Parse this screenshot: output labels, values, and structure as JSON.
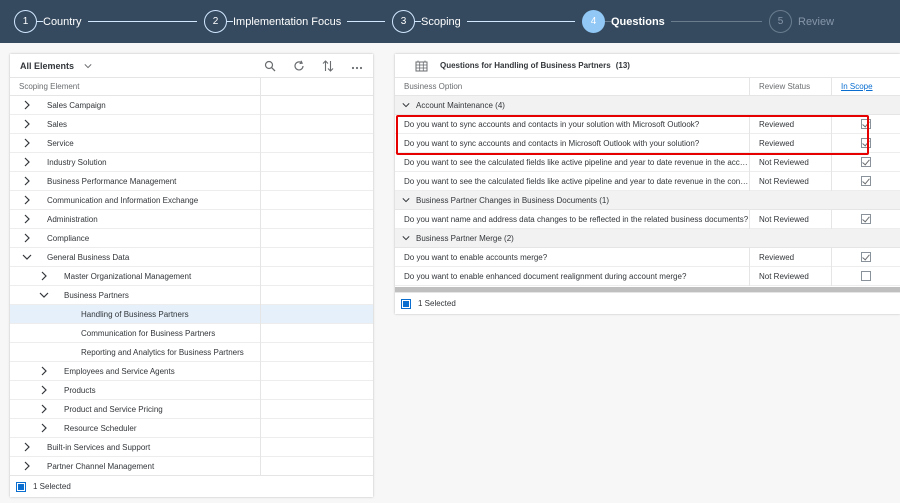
{
  "wizard": {
    "steps": [
      {
        "number": "1",
        "label": "Country"
      },
      {
        "number": "2",
        "label": "Implementation Focus"
      },
      {
        "number": "3",
        "label": "Scoping"
      },
      {
        "number": "4",
        "label": "Questions"
      },
      {
        "number": "5",
        "label": "Review"
      }
    ],
    "active_step": "4"
  },
  "left": {
    "filter_label": "All Elements",
    "column_header": "Scoping Element",
    "rows": [
      {
        "label": "Sales Campaign",
        "level": 0,
        "expanded": false
      },
      {
        "label": "Sales",
        "level": 0,
        "expanded": false
      },
      {
        "label": "Service",
        "level": 0,
        "expanded": false
      },
      {
        "label": "Industry Solution",
        "level": 0,
        "expanded": false
      },
      {
        "label": "Business Performance Management",
        "level": 0,
        "expanded": false
      },
      {
        "label": "Communication and Information Exchange",
        "level": 0,
        "expanded": false
      },
      {
        "label": "Administration",
        "level": 0,
        "expanded": false
      },
      {
        "label": "Compliance",
        "level": 0,
        "expanded": false
      },
      {
        "label": "General Business Data",
        "level": 0,
        "expanded": true
      },
      {
        "label": "Master Organizational Management",
        "level": 1,
        "expanded": false
      },
      {
        "label": "Business Partners",
        "level": 1,
        "expanded": true
      },
      {
        "label": "Handling of Business Partners",
        "level": 2,
        "selected": true
      },
      {
        "label": "Communication for Business Partners",
        "level": 2
      },
      {
        "label": "Reporting and Analytics for Business Partners",
        "level": 2
      },
      {
        "label": "Employees and Service Agents",
        "level": 1,
        "expanded": false
      },
      {
        "label": "Products",
        "level": 1,
        "expanded": false
      },
      {
        "label": "Product and Service Pricing",
        "level": 1,
        "expanded": false
      },
      {
        "label": "Resource Scheduler",
        "level": 1,
        "expanded": false
      },
      {
        "label": "Built-in Services and Support",
        "level": 0,
        "expanded": false
      },
      {
        "label": "Partner Channel Management",
        "level": 0,
        "expanded": false
      }
    ],
    "footer_text": "1 Selected"
  },
  "right": {
    "title": "Questions for Handling of Business Partners",
    "count": "(13)",
    "headers": {
      "option": "Business Option",
      "status": "Review Status",
      "scope": "In Scope"
    },
    "groups": [
      {
        "label": "Account Maintenance (4)",
        "rows": [
          {
            "option": "Do you want to sync accounts and contacts in your solution with Microsoft Outlook?",
            "status": "Reviewed",
            "in_scope": true
          },
          {
            "option": "Do you want to sync accounts and contacts in Microsoft Outlook with your solution?",
            "status": "Reviewed",
            "in_scope": true
          },
          {
            "option": "Do you want to see the calculated fields like active pipeline and year to date revenue in the account data?",
            "status": "Not Reviewed",
            "in_scope": true
          },
          {
            "option": "Do you want to see the calculated fields like active pipeline and year to date revenue in the contact data?",
            "status": "Not Reviewed",
            "in_scope": true
          }
        ]
      },
      {
        "label": "Business Partner Changes in Business Documents (1)",
        "rows": [
          {
            "option": "Do you want name and address data changes to be reflected in the related business documents?",
            "status": "Not Reviewed",
            "in_scope": true
          }
        ]
      },
      {
        "label": "Business Partner Merge (2)",
        "rows": [
          {
            "option": "Do you want to enable accounts merge?",
            "status": "Reviewed",
            "in_scope": true
          },
          {
            "option": "Do you want to enable enhanced document realignment during account merge?",
            "status": "Not Reviewed",
            "in_scope": false
          }
        ]
      }
    ],
    "footer_text": "1 Selected"
  },
  "colors": {
    "header_bg": "#354a5f",
    "active_step": "#91c8f6",
    "highlight": "#e60000",
    "accent": "#0a6ed1"
  }
}
